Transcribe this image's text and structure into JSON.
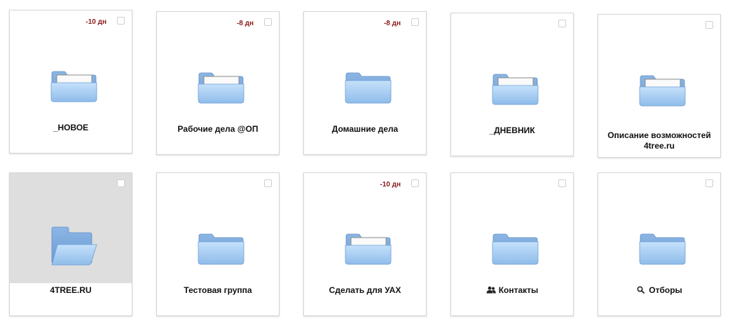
{
  "cards": [
    {
      "title": "_НОВОЕ",
      "days": "-10 дн",
      "folder": "folder-with-paper-icon",
      "selected": false
    },
    {
      "title": "Рабочие дела @ОП",
      "days": "-8 дн",
      "folder": "folder-with-paper-icon",
      "selected": false
    },
    {
      "title": "Домашние дела",
      "days": "-8 дн",
      "folder": "folder-icon",
      "selected": false
    },
    {
      "title": "_ДНЕВНИК",
      "days": "",
      "folder": "folder-with-paper-icon",
      "selected": false
    },
    {
      "title": "Описание возможностей 4tree.ru",
      "days": "",
      "folder": "folder-with-paper-icon",
      "selected": false
    },
    {
      "title": "4TREE.RU",
      "days": "",
      "folder": "open-folder-icon",
      "selected": true
    },
    {
      "title": "Тестовая группа",
      "days": "",
      "folder": "folder-icon",
      "selected": false
    },
    {
      "title": "Сделать для УАХ",
      "days": "-10 дн",
      "folder": "folder-with-paper-icon",
      "selected": false
    },
    {
      "title": "Контакты",
      "days": "",
      "folder": "folder-icon",
      "label_icon": "contacts-icon",
      "selected": false
    },
    {
      "title": "Отборы",
      "days": "",
      "folder": "folder-icon",
      "label_icon": "search-icon",
      "selected": false
    }
  ],
  "colors": {
    "days": "#8b1a1a",
    "folder_light": "#b6d7f7",
    "folder_dark": "#6c9fd6",
    "selected_bg": "#dedede"
  }
}
